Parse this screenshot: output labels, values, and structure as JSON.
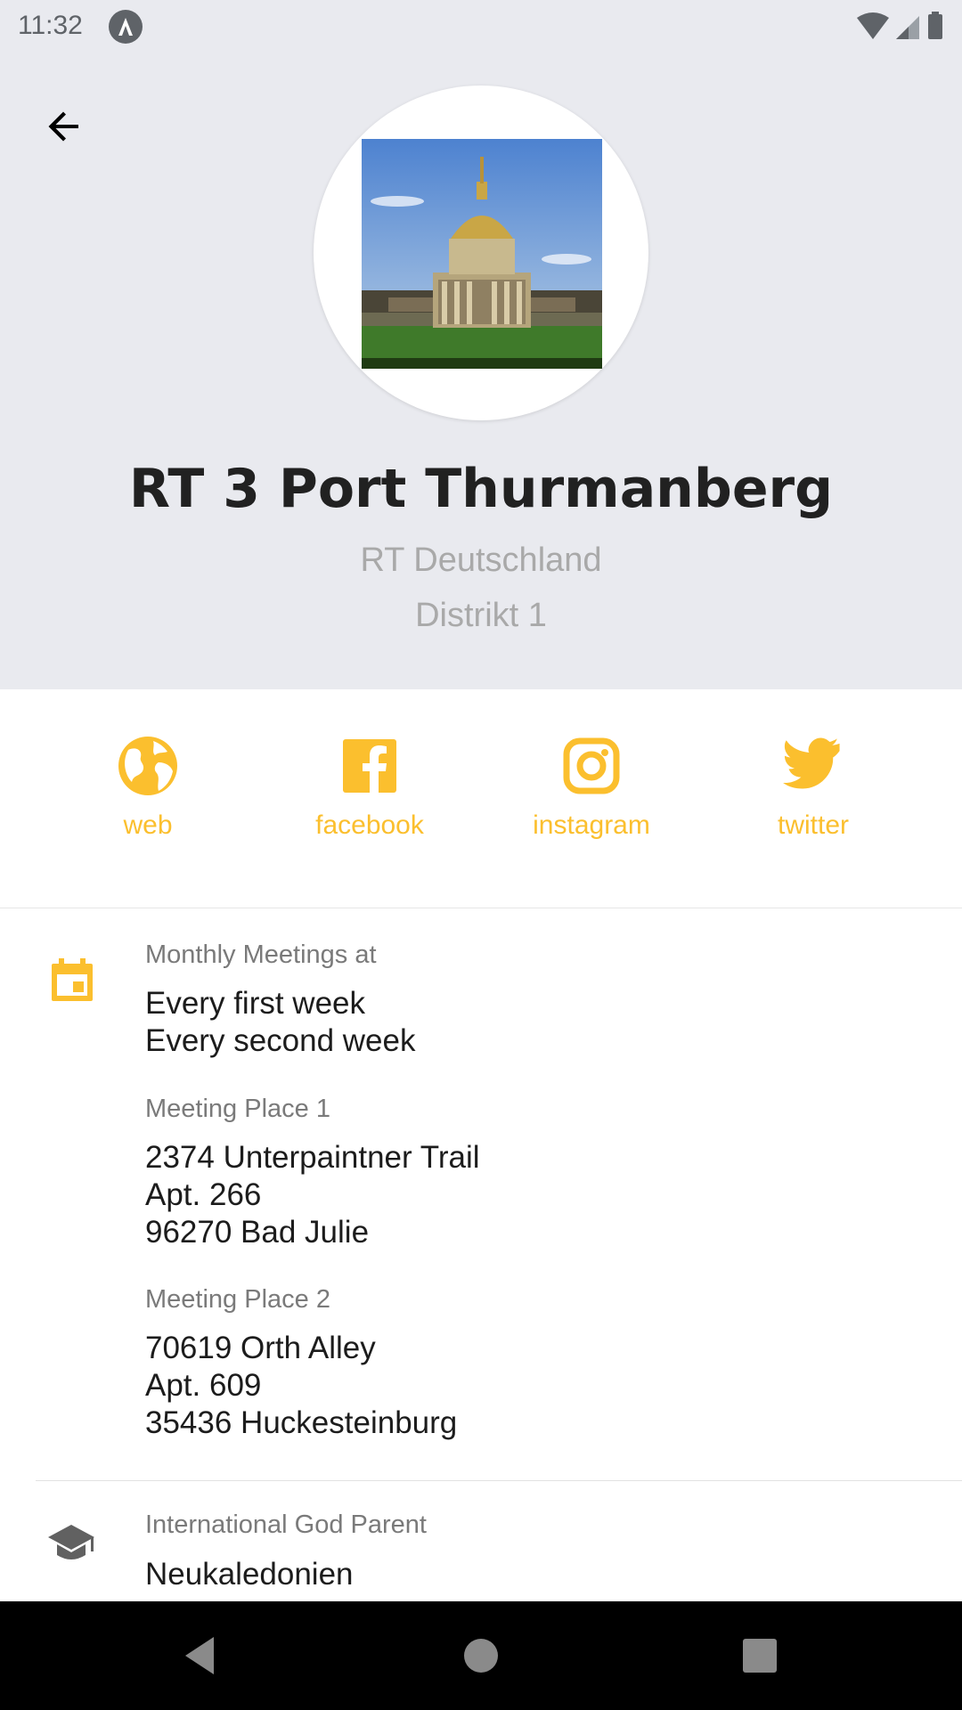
{
  "status_bar": {
    "time": "11:32"
  },
  "header": {
    "back_icon": "arrow-left-icon",
    "title": "RT 3 Port Thurmanberg",
    "subtitle_1": "RT Deutschland",
    "subtitle_2": "Distrikt 1"
  },
  "social": [
    {
      "label": "web",
      "icon": "globe-icon"
    },
    {
      "label": "facebook",
      "icon": "facebook-icon"
    },
    {
      "label": "instagram",
      "icon": "instagram-icon"
    },
    {
      "label": "twitter",
      "icon": "twitter-icon"
    }
  ],
  "details": {
    "meetings": {
      "label": "Monthly Meetings at",
      "lines": [
        "Every first week",
        "Every second week"
      ]
    },
    "place_1": {
      "label": "Meeting Place 1",
      "lines": [
        "2374 Unterpaintner Trail",
        "Apt. 266",
        "96270 Bad Julie"
      ]
    },
    "place_2": {
      "label": "Meeting Place 2",
      "lines": [
        "70619 Orth Alley",
        "Apt. 609",
        "35436 Huckesteinburg"
      ]
    },
    "god_parent": {
      "label": "International God Parent",
      "value": "Neukaledonien"
    }
  },
  "colors": {
    "accent": "#fbbf2e",
    "header_bg": "#e9eaef",
    "title": "#212121",
    "subtitle": "#a9a9a9"
  }
}
